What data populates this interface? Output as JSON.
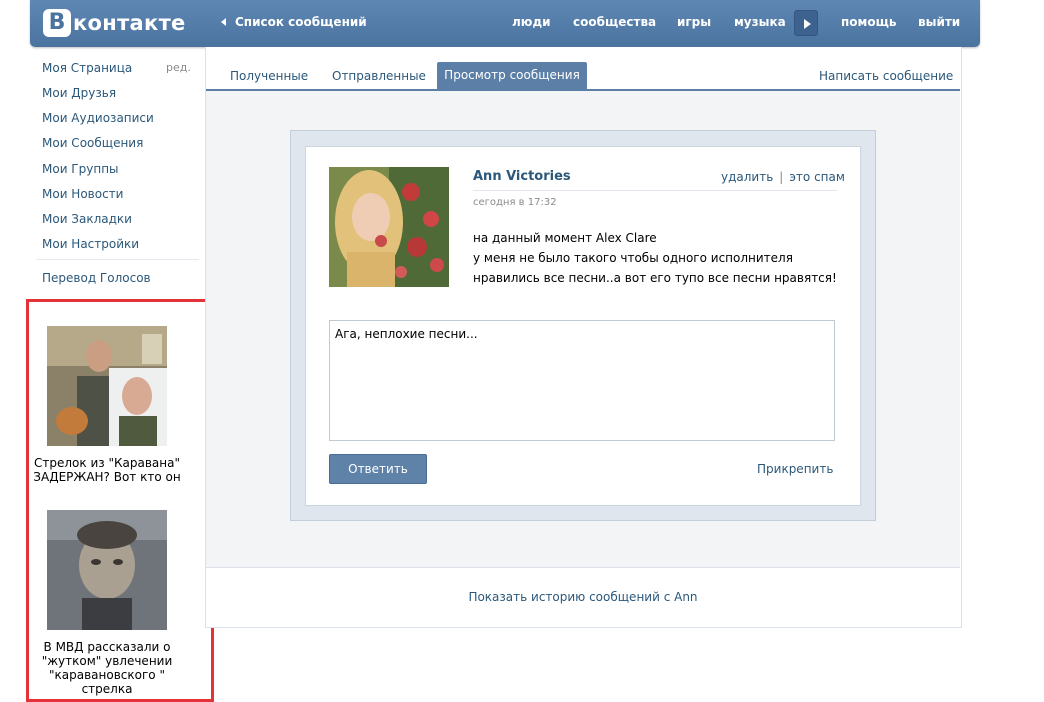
{
  "header": {
    "logo_letter": "В",
    "logo_text": "контакте",
    "back_label": "Список сообщений",
    "nav": [
      "люди",
      "сообщества",
      "игры",
      "музыка",
      "помощь",
      "выйти"
    ]
  },
  "sidebar": {
    "items": [
      {
        "label": "Моя Страница"
      },
      {
        "label": "Мои Друзья"
      },
      {
        "label": "Мои Аудиозаписи"
      },
      {
        "label": "Мои Сообщения"
      },
      {
        "label": "Мои Группы"
      },
      {
        "label": "Мои Новости"
      },
      {
        "label": "Мои Закладки"
      },
      {
        "label": "Мои Настройки"
      }
    ],
    "edit_label": "ред.",
    "extra_label": "Перевод Голосов"
  },
  "ads": [
    {
      "text": "Стрелок из \"Каравана\" ЗАДЕРЖАН? Вот кто он"
    },
    {
      "text": "В МВД рассказали о \"жутком\" увлечении \"каравановского \" стрелка"
    }
  ],
  "tabs": {
    "received": "Полученные",
    "sent": "Отправленные",
    "view": "Просмотр сообщения",
    "compose": "Написать сообщение"
  },
  "message": {
    "sender": "Ann Victories",
    "delete_label": "удалить",
    "spam_label": "это спам",
    "timestamp": "сегодня в 17:32",
    "lines": [
      "на данный момент Alex Clare",
      "у меня не было такого чтобы одного исполнителя",
      "нравились все песни..а вот его тупо все песни нравятся!"
    ]
  },
  "reply": {
    "value": "Ага, неплохие песни...",
    "send_label": "Ответить",
    "attach_label": "Прикрепить"
  },
  "history_label": "Показать историю сообщений с Ann",
  "colors": {
    "accent": "#5b7fa6",
    "link": "#2b587a",
    "ad_border": "#e53238"
  }
}
